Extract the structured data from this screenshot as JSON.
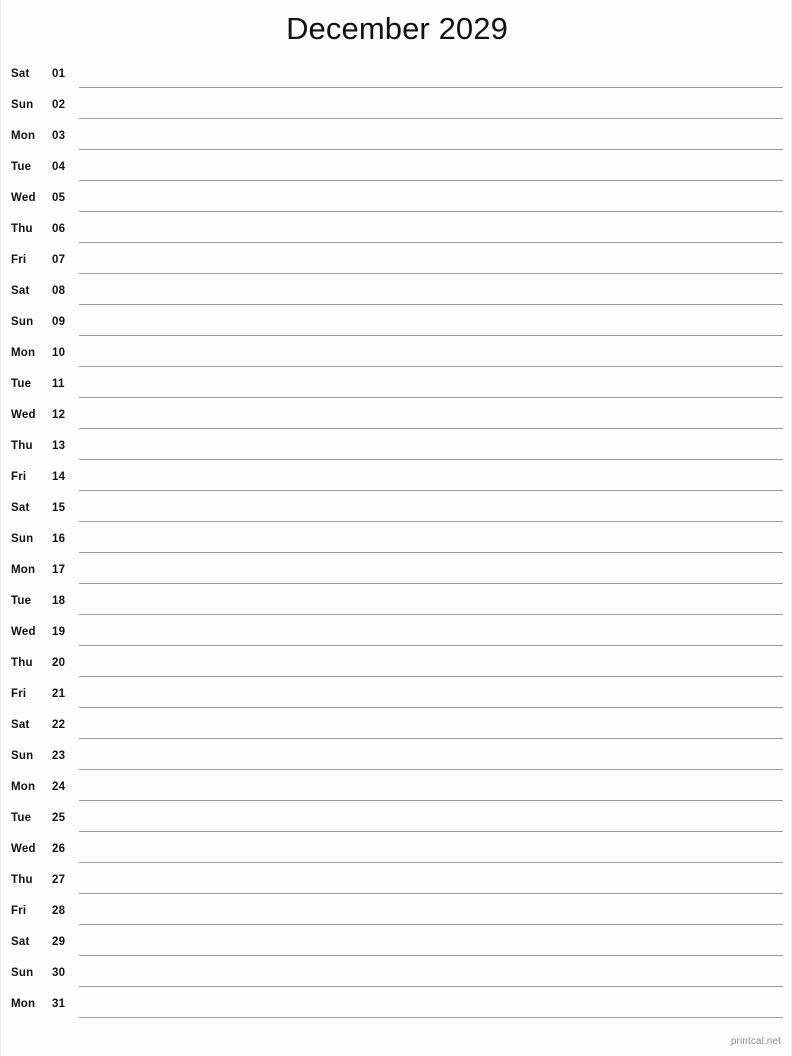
{
  "document": {
    "type": "printable-monthly-calendar",
    "layout": "single-column-notes",
    "background_color": "#fdfdfa",
    "rule_line_color": "#9a9a9a",
    "text_color": "#111111"
  },
  "header": {
    "title": "December 2029",
    "month": "December",
    "year": "2029"
  },
  "calendar": {
    "day_count": 31,
    "days": [
      {
        "weekday": "Sat",
        "date": "01"
      },
      {
        "weekday": "Sun",
        "date": "02"
      },
      {
        "weekday": "Mon",
        "date": "03"
      },
      {
        "weekday": "Tue",
        "date": "04"
      },
      {
        "weekday": "Wed",
        "date": "05"
      },
      {
        "weekday": "Thu",
        "date": "06"
      },
      {
        "weekday": "Fri",
        "date": "07"
      },
      {
        "weekday": "Sat",
        "date": "08"
      },
      {
        "weekday": "Sun",
        "date": "09"
      },
      {
        "weekday": "Mon",
        "date": "10"
      },
      {
        "weekday": "Tue",
        "date": "11"
      },
      {
        "weekday": "Wed",
        "date": "12"
      },
      {
        "weekday": "Thu",
        "date": "13"
      },
      {
        "weekday": "Fri",
        "date": "14"
      },
      {
        "weekday": "Sat",
        "date": "15"
      },
      {
        "weekday": "Sun",
        "date": "16"
      },
      {
        "weekday": "Mon",
        "date": "17"
      },
      {
        "weekday": "Tue",
        "date": "18"
      },
      {
        "weekday": "Wed",
        "date": "19"
      },
      {
        "weekday": "Thu",
        "date": "20"
      },
      {
        "weekday": "Fri",
        "date": "21"
      },
      {
        "weekday": "Sat",
        "date": "22"
      },
      {
        "weekday": "Sun",
        "date": "23"
      },
      {
        "weekday": "Mon",
        "date": "24"
      },
      {
        "weekday": "Tue",
        "date": "25"
      },
      {
        "weekday": "Wed",
        "date": "26"
      },
      {
        "weekday": "Thu",
        "date": "27"
      },
      {
        "weekday": "Fri",
        "date": "28"
      },
      {
        "weekday": "Sat",
        "date": "29"
      },
      {
        "weekday": "Sun",
        "date": "30"
      },
      {
        "weekday": "Mon",
        "date": "31"
      }
    ]
  },
  "footer": {
    "credit": "printcal.net"
  }
}
